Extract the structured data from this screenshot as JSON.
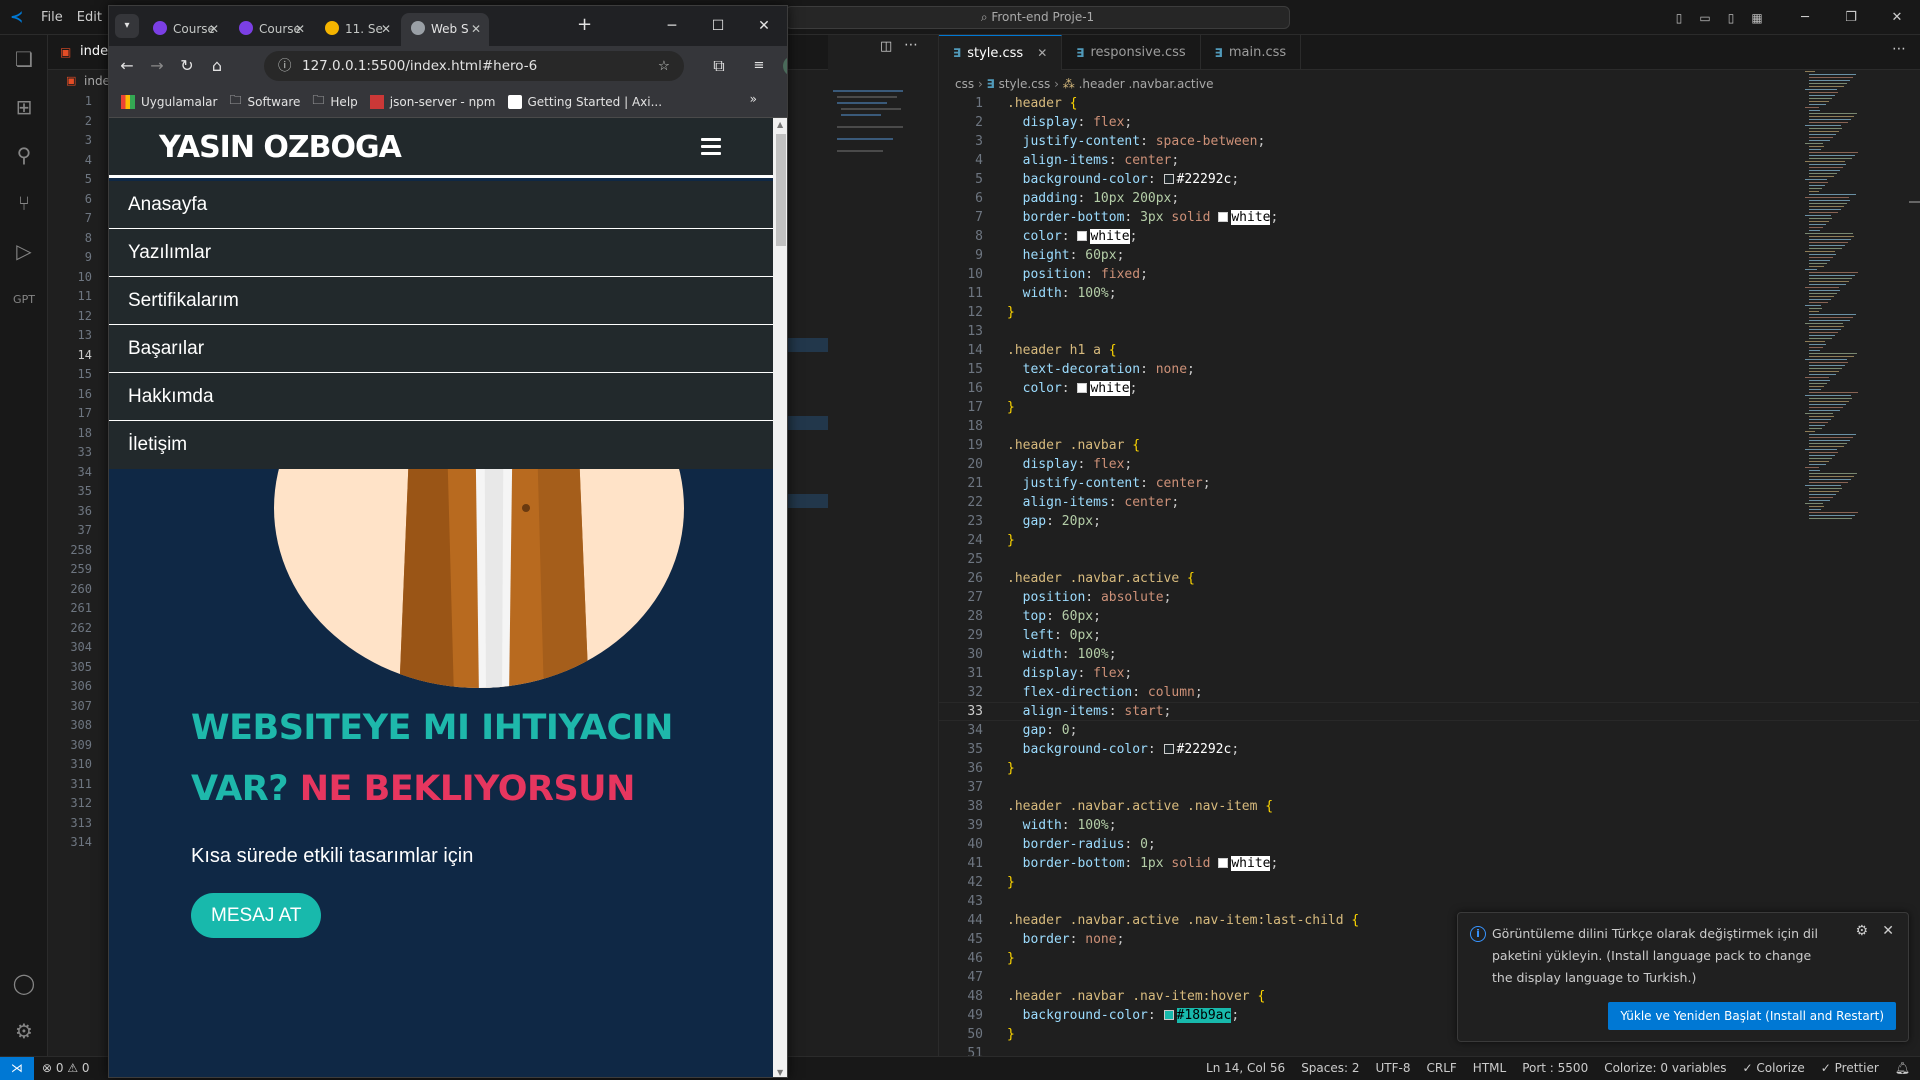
{
  "vscode": {
    "menu": [
      "File",
      "Edit"
    ],
    "command_center": "Front-end Proje-1",
    "left_tab_label": "index",
    "left_tab_label2": "inde",
    "left_line_numbers": [
      "1",
      "2",
      "3",
      "4",
      "5",
      "6",
      "7",
      "8",
      "9",
      "10",
      "11",
      "12",
      "13",
      "14",
      "15",
      "16",
      "17",
      "18",
      "33",
      "34",
      "35",
      "36",
      "37",
      "258",
      "259",
      "260",
      "261",
      "262",
      "304",
      "305",
      "306",
      "307",
      "308",
      "309",
      "310",
      "311",
      "312",
      "313",
      "314"
    ],
    "editor_tabs": [
      {
        "label": "style.css",
        "active": true
      },
      {
        "label": "responsive.css",
        "active": false
      },
      {
        "label": "main.css",
        "active": false
      }
    ],
    "breadcrumb": {
      "folder": "css",
      "file": "style.css",
      "symbol": ".header .navbar.active"
    },
    "code_lines": [
      {
        "n": "1",
        "tokens": [
          [
            ".header ",
            "sel"
          ],
          [
            "{",
            "brace"
          ]
        ]
      },
      {
        "n": "2",
        "tokens": [
          [
            "  display",
            "prop"
          ],
          [
            ": ",
            "pun"
          ],
          [
            "flex",
            "val"
          ],
          [
            ";",
            "pun"
          ]
        ]
      },
      {
        "n": "3",
        "tokens": [
          [
            "  justify-content",
            "prop"
          ],
          [
            ": ",
            "pun"
          ],
          [
            "space-between",
            "val"
          ],
          [
            ";",
            "pun"
          ]
        ]
      },
      {
        "n": "4",
        "tokens": [
          [
            "  align-items",
            "prop"
          ],
          [
            ": ",
            "pun"
          ],
          [
            "center",
            "val"
          ],
          [
            ";",
            "pun"
          ]
        ]
      },
      {
        "n": "5",
        "tokens": [
          [
            "  background-color",
            "prop"
          ],
          [
            ": ",
            "pun"
          ],
          [
            "#22292c",
            "swatch:#22292c"
          ],
          [
            ";",
            "pun"
          ]
        ]
      },
      {
        "n": "6",
        "tokens": [
          [
            "  padding",
            "prop"
          ],
          [
            ": ",
            "pun"
          ],
          [
            "10px 200px",
            "num"
          ],
          [
            ";",
            "pun"
          ]
        ]
      },
      {
        "n": "7",
        "tokens": [
          [
            "  border-bottom",
            "prop"
          ],
          [
            ": ",
            "pun"
          ],
          [
            "3px ",
            "num"
          ],
          [
            "solid ",
            "val"
          ],
          [
            "white",
            "swatchhl:#ffffff"
          ],
          [
            ";",
            "pun"
          ]
        ]
      },
      {
        "n": "8",
        "tokens": [
          [
            "  color",
            "prop"
          ],
          [
            ": ",
            "pun"
          ],
          [
            "white",
            "swatchhl:#ffffff"
          ],
          [
            ";",
            "pun"
          ]
        ]
      },
      {
        "n": "9",
        "tokens": [
          [
            "  height",
            "prop"
          ],
          [
            ": ",
            "pun"
          ],
          [
            "60px",
            "num"
          ],
          [
            ";",
            "pun"
          ]
        ]
      },
      {
        "n": "10",
        "tokens": [
          [
            "  position",
            "prop"
          ],
          [
            ": ",
            "pun"
          ],
          [
            "fixed",
            "val"
          ],
          [
            ";",
            "pun"
          ]
        ]
      },
      {
        "n": "11",
        "tokens": [
          [
            "  width",
            "prop"
          ],
          [
            ": ",
            "pun"
          ],
          [
            "100%",
            "num"
          ],
          [
            ";",
            "pun"
          ]
        ]
      },
      {
        "n": "12",
        "tokens": [
          [
            "}",
            "brace"
          ]
        ]
      },
      {
        "n": "13",
        "tokens": []
      },
      {
        "n": "14",
        "tokens": [
          [
            ".header h1 a ",
            "sel"
          ],
          [
            "{",
            "brace"
          ]
        ]
      },
      {
        "n": "15",
        "tokens": [
          [
            "  text-decoration",
            "prop"
          ],
          [
            ": ",
            "pun"
          ],
          [
            "none",
            "val"
          ],
          [
            ";",
            "pun"
          ]
        ]
      },
      {
        "n": "16",
        "tokens": [
          [
            "  color",
            "prop"
          ],
          [
            ": ",
            "pun"
          ],
          [
            "white",
            "swatchhl:#ffffff"
          ],
          [
            ";",
            "pun"
          ]
        ]
      },
      {
        "n": "17",
        "tokens": [
          [
            "}",
            "brace"
          ]
        ]
      },
      {
        "n": "18",
        "tokens": []
      },
      {
        "n": "19",
        "tokens": [
          [
            ".header .navbar ",
            "sel"
          ],
          [
            "{",
            "brace"
          ]
        ]
      },
      {
        "n": "20",
        "tokens": [
          [
            "  display",
            "prop"
          ],
          [
            ": ",
            "pun"
          ],
          [
            "flex",
            "val"
          ],
          [
            ";",
            "pun"
          ]
        ]
      },
      {
        "n": "21",
        "tokens": [
          [
            "  justify-content",
            "prop"
          ],
          [
            ": ",
            "pun"
          ],
          [
            "center",
            "val"
          ],
          [
            ";",
            "pun"
          ]
        ]
      },
      {
        "n": "22",
        "tokens": [
          [
            "  align-items",
            "prop"
          ],
          [
            ": ",
            "pun"
          ],
          [
            "center",
            "val"
          ],
          [
            ";",
            "pun"
          ]
        ]
      },
      {
        "n": "23",
        "tokens": [
          [
            "  gap",
            "prop"
          ],
          [
            ": ",
            "pun"
          ],
          [
            "20px",
            "num"
          ],
          [
            ";",
            "pun"
          ]
        ]
      },
      {
        "n": "24",
        "tokens": [
          [
            "}",
            "brace"
          ]
        ]
      },
      {
        "n": "25",
        "tokens": []
      },
      {
        "n": "26",
        "tokens": [
          [
            ".header .navbar.active ",
            "sel"
          ],
          [
            "{",
            "brace"
          ]
        ]
      },
      {
        "n": "27",
        "tokens": [
          [
            "  position",
            "prop"
          ],
          [
            ": ",
            "pun"
          ],
          [
            "absolute",
            "val"
          ],
          [
            ";",
            "pun"
          ]
        ]
      },
      {
        "n": "28",
        "tokens": [
          [
            "  top",
            "prop"
          ],
          [
            ": ",
            "pun"
          ],
          [
            "60px",
            "num"
          ],
          [
            ";",
            "pun"
          ]
        ]
      },
      {
        "n": "29",
        "tokens": [
          [
            "  left",
            "prop"
          ],
          [
            ": ",
            "pun"
          ],
          [
            "0px",
            "num"
          ],
          [
            ";",
            "pun"
          ]
        ]
      },
      {
        "n": "30",
        "tokens": [
          [
            "  width",
            "prop"
          ],
          [
            ": ",
            "pun"
          ],
          [
            "100%",
            "num"
          ],
          [
            ";",
            "pun"
          ]
        ]
      },
      {
        "n": "31",
        "tokens": [
          [
            "  display",
            "prop"
          ],
          [
            ": ",
            "pun"
          ],
          [
            "flex",
            "val"
          ],
          [
            ";",
            "pun"
          ]
        ]
      },
      {
        "n": "32",
        "tokens": [
          [
            "  flex-direction",
            "prop"
          ],
          [
            ": ",
            "pun"
          ],
          [
            "column",
            "val"
          ],
          [
            ";",
            "pun"
          ]
        ]
      },
      {
        "n": "33",
        "tokens": [
          [
            "  align-items",
            "prop"
          ],
          [
            ": ",
            "pun"
          ],
          [
            "start",
            "val"
          ],
          [
            ";",
            "pun"
          ]
        ]
      },
      {
        "n": "34",
        "tokens": [
          [
            "  gap",
            "prop"
          ],
          [
            ": ",
            "pun"
          ],
          [
            "0",
            "num"
          ],
          [
            ";",
            "pun"
          ]
        ]
      },
      {
        "n": "35",
        "tokens": [
          [
            "  background-color",
            "prop"
          ],
          [
            ": ",
            "pun"
          ],
          [
            "#22292c",
            "swatch:#22292c"
          ],
          [
            ";",
            "pun"
          ]
        ]
      },
      {
        "n": "36",
        "tokens": [
          [
            "}",
            "brace"
          ]
        ]
      },
      {
        "n": "37",
        "tokens": []
      },
      {
        "n": "38",
        "tokens": [
          [
            ".header .navbar.active .nav-item ",
            "sel"
          ],
          [
            "{",
            "brace"
          ]
        ]
      },
      {
        "n": "39",
        "tokens": [
          [
            "  width",
            "prop"
          ],
          [
            ": ",
            "pun"
          ],
          [
            "100%",
            "num"
          ],
          [
            ";",
            "pun"
          ]
        ]
      },
      {
        "n": "40",
        "tokens": [
          [
            "  border-radius",
            "prop"
          ],
          [
            ": ",
            "pun"
          ],
          [
            "0",
            "num"
          ],
          [
            ";",
            "pun"
          ]
        ]
      },
      {
        "n": "41",
        "tokens": [
          [
            "  border-bottom",
            "prop"
          ],
          [
            ": ",
            "pun"
          ],
          [
            "1px ",
            "num"
          ],
          [
            "solid ",
            "val"
          ],
          [
            "white",
            "swatchhl:#ffffff"
          ],
          [
            ";",
            "pun"
          ]
        ]
      },
      {
        "n": "42",
        "tokens": [
          [
            "}",
            "brace"
          ]
        ]
      },
      {
        "n": "43",
        "tokens": []
      },
      {
        "n": "44",
        "tokens": [
          [
            ".header .navbar.active .nav-item:last-child ",
            "sel"
          ],
          [
            "{",
            "brace"
          ]
        ]
      },
      {
        "n": "45",
        "tokens": [
          [
            "  border",
            "prop"
          ],
          [
            ": ",
            "pun"
          ],
          [
            "none",
            "val"
          ],
          [
            ";",
            "pun"
          ]
        ]
      },
      {
        "n": "46",
        "tokens": [
          [
            "}",
            "brace"
          ]
        ]
      },
      {
        "n": "47",
        "tokens": []
      },
      {
        "n": "48",
        "tokens": [
          [
            ".header .navbar .nav-item:hover ",
            "sel"
          ],
          [
            "{",
            "brace"
          ]
        ]
      },
      {
        "n": "49",
        "tokens": [
          [
            "  background-color",
            "prop"
          ],
          [
            ": ",
            "pun"
          ],
          [
            "#18b9ac",
            "swatchteal:#18b9ac"
          ],
          [
            ";",
            "pun"
          ]
        ]
      },
      {
        "n": "50",
        "tokens": [
          [
            "}",
            "brace"
          ]
        ]
      },
      {
        "n": "51",
        "tokens": []
      }
    ],
    "current_line": "33",
    "notification": {
      "message": "Görüntüleme dilini Türkçe olarak değiştirmek için dil paketini yükleyin. (Install language pack to change the display language to Turkish.)",
      "button": "Yükle ve Yeniden Başlat (Install and Restart)"
    },
    "status": {
      "problems": "⊗ 0 ⚠ 0",
      "items": [
        "Ln 14, Col 56",
        "Spaces: 2",
        "UTF-8",
        "CRLF",
        "HTML",
        "Port : 5500",
        "Colorize: 0 variables",
        "✓ Colorize",
        "✓ Prettier"
      ]
    }
  },
  "browser": {
    "tabs": [
      {
        "label": "Course",
        "color": "#7b3fe4"
      },
      {
        "label": "Course",
        "color": "#7b3fe4"
      },
      {
        "label": "11. Se",
        "color": "#f4b400"
      },
      {
        "label": "Web S",
        "color": "#9aa0a6"
      }
    ],
    "url": "127.0.0.1:5500/index.html#hero-6",
    "bookmarks": [
      "Uygulamalar",
      "Software",
      "Help",
      "json-server - npm",
      "Getting Started | Axi..."
    ]
  },
  "site": {
    "logo": "YASIN OZBOGA",
    "nav": [
      "Anasayfa",
      "Yazılımlar",
      "Sertifikalarım",
      "Başarılar",
      "Hakkımda",
      "İletişim"
    ],
    "hero_title_1": "WEBSITEYE MI IHTIYACIN VAR?",
    "hero_title_2": "NE BEKLIYORSUN",
    "hero_sub": "Kısa sürede etkili tasarımlar için",
    "hero_button": "MESAJ AT"
  }
}
